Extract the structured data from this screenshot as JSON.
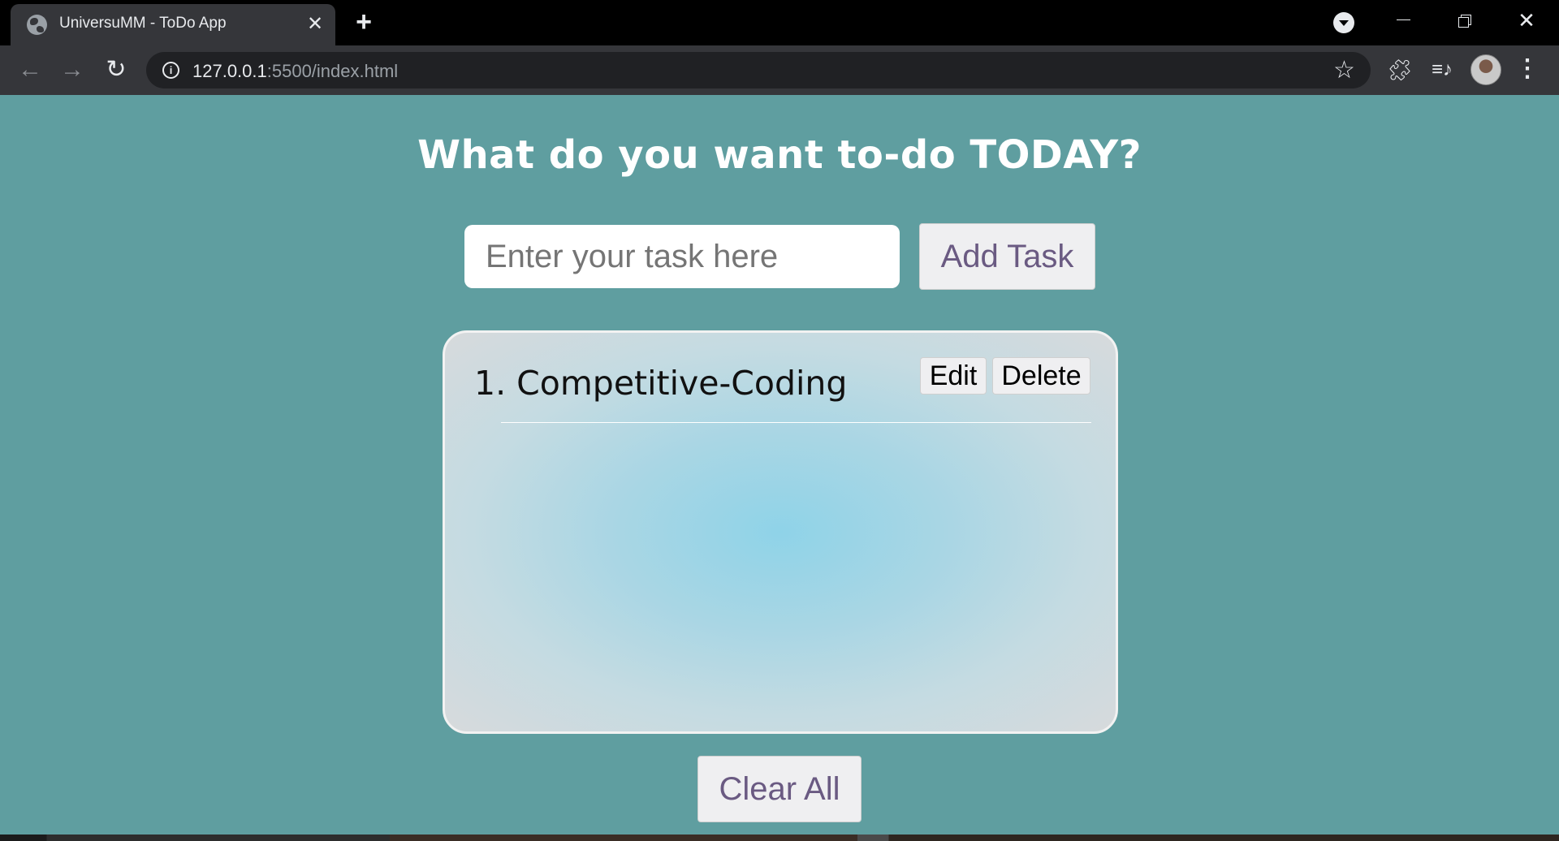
{
  "browser": {
    "tab_title": "UniversuMM - ToDo App",
    "tab_close": "✕",
    "new_tab": "+",
    "url_host": "127.0.0.1",
    "url_path": ":5500/index.html",
    "icons": {
      "favicon": "globe-icon",
      "back": "arrow-left-icon",
      "forward": "arrow-right-icon",
      "reload": "reload-icon",
      "info": "info-icon",
      "bookmark": "star-icon",
      "extensions": "puzzle-icon",
      "media": "media-queue-icon",
      "menu": "kebab-menu-icon"
    }
  },
  "app": {
    "heading": "What do you want to-do TODAY?",
    "input_placeholder": "Enter your task here",
    "add_button": "Add Task",
    "tasks": [
      {
        "text": "1. Competitive-Coding",
        "edit_label": "Edit",
        "delete_label": "Delete"
      }
    ],
    "clear_button": "Clear All",
    "colors": {
      "background": "#5f9ea0",
      "card_center": "#8fd3e8",
      "card_edge": "#d7dadc",
      "button_text": "#6a5a82"
    }
  }
}
